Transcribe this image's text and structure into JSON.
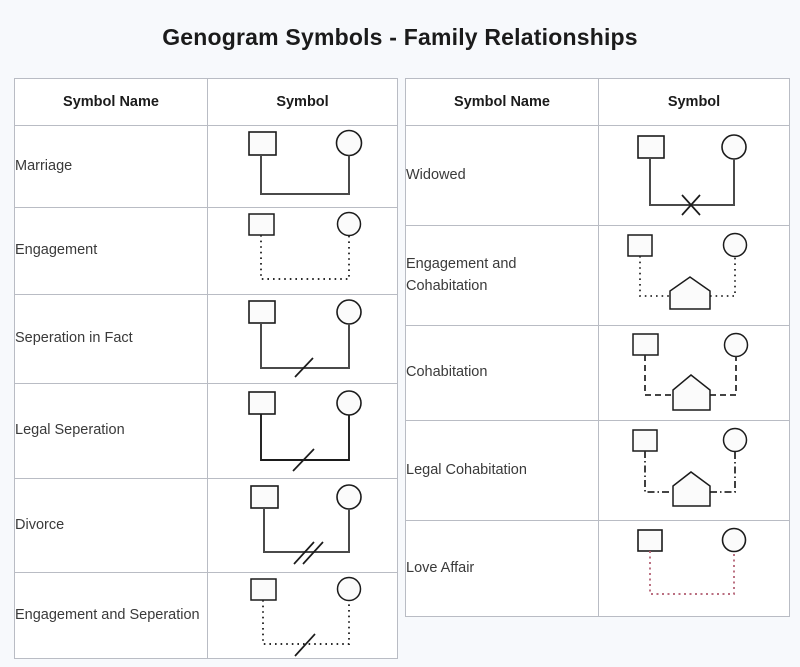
{
  "page": {
    "title": "Genogram Symbols - Family Relationships",
    "background_color": "#f7f9fc",
    "table_border_color": "#b9bcc4",
    "stroke_color": "#1b1b1b",
    "accent_color": "#b05a6e"
  },
  "tables": [
    {
      "id": "left",
      "headers": {
        "name": "Symbol Name",
        "symbol": "Symbol"
      },
      "rows": [
        {
          "name": "Marriage",
          "symbol": "marriage-symbol"
        },
        {
          "name": "Engagement",
          "symbol": "engagement-symbol"
        },
        {
          "name": "Seperation in Fact",
          "symbol": "separation-in-fact-symbol"
        },
        {
          "name": "Legal Seperation",
          "symbol": "legal-separation-symbol"
        },
        {
          "name": "Divorce",
          "symbol": "divorce-symbol"
        },
        {
          "name": "Engagement and Seperation",
          "symbol": "engagement-and-separation-symbol"
        }
      ]
    },
    {
      "id": "right",
      "headers": {
        "name": "Symbol Name",
        "symbol": "Symbol"
      },
      "rows": [
        {
          "name": "Widowed",
          "symbol": "widowed-symbol"
        },
        {
          "name": "Engagement and Cohabitation",
          "symbol": "engagement-and-cohabitation-symbol"
        },
        {
          "name": "Cohabitation",
          "symbol": "cohabitation-symbol"
        },
        {
          "name": "Legal Cohabitation",
          "symbol": "legal-cohabitation-symbol"
        },
        {
          "name": "Love Affair",
          "symbol": "love-affair-symbol"
        }
      ]
    }
  ],
  "symbol_spec": {
    "male": "square",
    "female": "circle",
    "cohabitation_marker": "house-pentagon",
    "marriage": {
      "line": "solid",
      "marker": "none"
    },
    "engagement": {
      "line": "dotted",
      "marker": "none"
    },
    "separation-in-fact": {
      "line": "solid",
      "marker": "single-slash"
    },
    "legal-separation": {
      "line": "solid",
      "marker": "single-slash"
    },
    "divorce": {
      "line": "solid",
      "marker": "double-slash"
    },
    "engagement-and-separation": {
      "line": "dotted",
      "marker": "single-slash"
    },
    "widowed": {
      "line": "solid",
      "marker": "cross"
    },
    "engagement-and-cohabitation": {
      "line": "dotted",
      "marker": "house"
    },
    "cohabitation": {
      "line": "dashed",
      "marker": "house"
    },
    "legal-cohabitation": {
      "line": "dash-dot",
      "marker": "house"
    },
    "love-affair": {
      "line": "dotted-accent",
      "marker": "none"
    }
  }
}
